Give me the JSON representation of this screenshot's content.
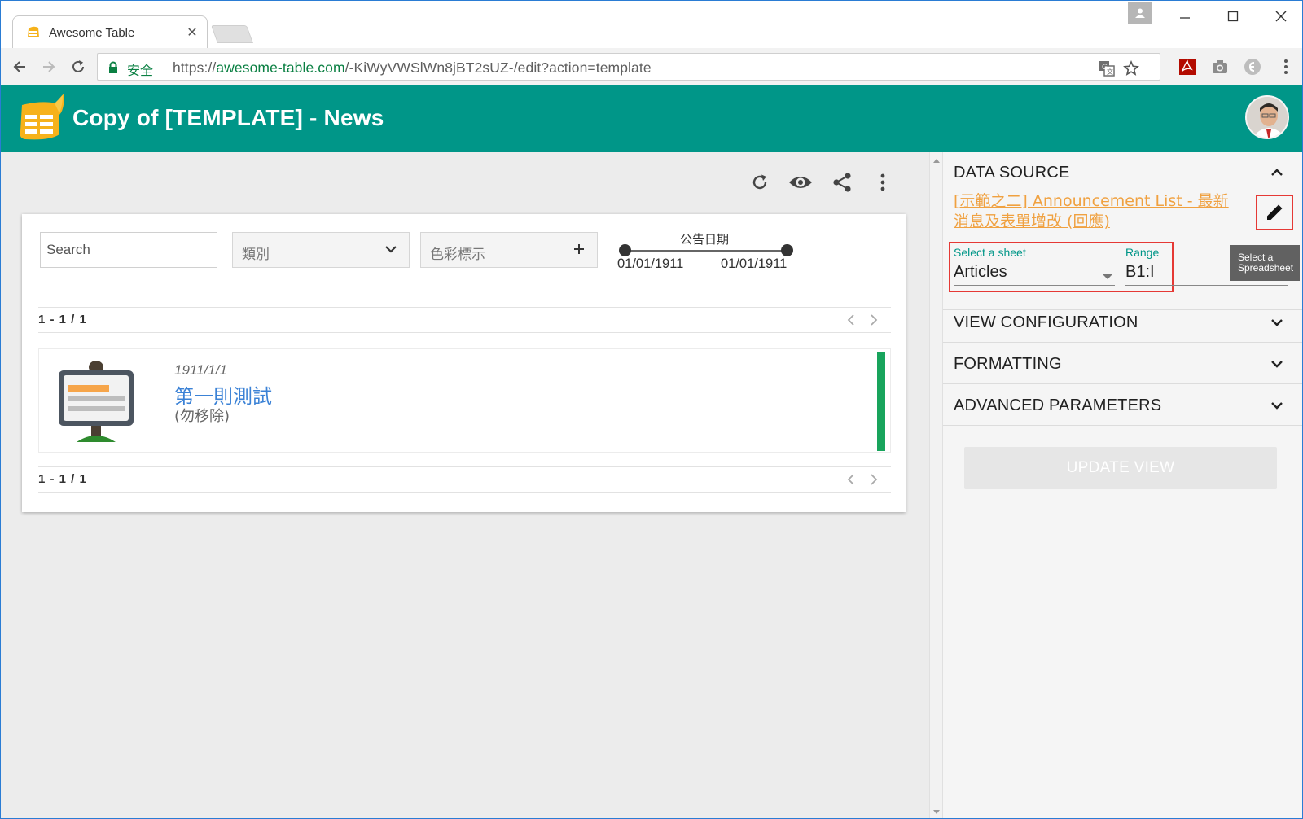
{
  "browser": {
    "tab_title": "Awesome Table",
    "secure_label": "安全",
    "url_scheme": "https://",
    "url_host": "awesome-table.com",
    "url_path": "/-KiWyVWSlWn8jBT2sUZ-/edit?action=template"
  },
  "app": {
    "title": "Copy of [TEMPLATE] - News"
  },
  "filters": {
    "search_placeholder": "Search",
    "category_label": "類別",
    "color_label": "色彩標示",
    "date_title": "公告日期",
    "date_from": "01/01/1911",
    "date_to": "01/01/1911"
  },
  "pagination": {
    "top": "1 - 1 / 1",
    "bottom": "1 - 1 / 1"
  },
  "news": [
    {
      "date": "1911/1/1",
      "title": "第一則測試",
      "subtitle": "(勿移除)"
    }
  ],
  "sidebar": {
    "data_source": {
      "title": "DATA SOURCE",
      "link_text": "[示範之二] Announcement List - 最新消息及表單增改 (回應)",
      "sheet_label": "Select a sheet",
      "sheet_value": "Articles",
      "range_label": "Range",
      "range_value": "B1:I",
      "tooltip": "Select a Spreadsheet"
    },
    "sections": [
      {
        "title": "VIEW CONFIGURATION"
      },
      {
        "title": "FORMATTING"
      },
      {
        "title": "ADVANCED PARAMETERS"
      }
    ],
    "update_button": "UPDATE VIEW"
  },
  "colors": {
    "header": "#009688",
    "link": "#f0a140",
    "news_title": "#3b82d6",
    "status_bar": "#18a45c",
    "highlight": "#e53935"
  }
}
